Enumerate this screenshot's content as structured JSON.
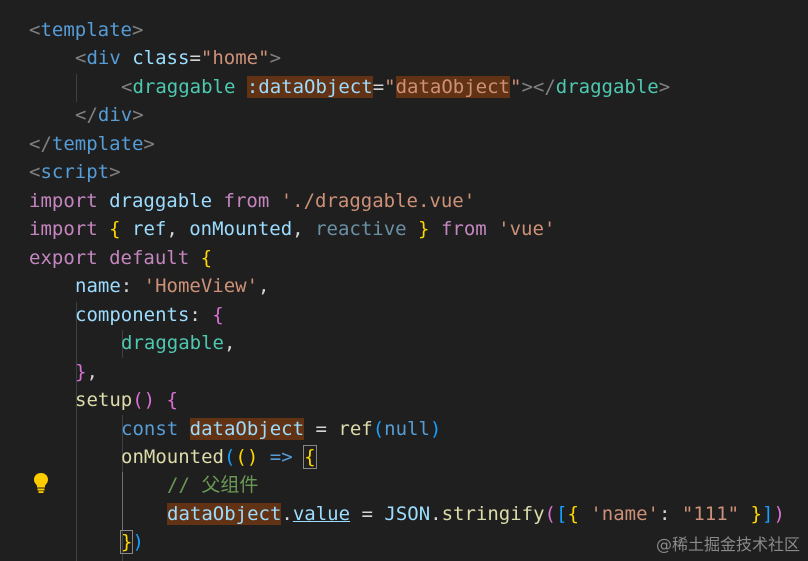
{
  "editor": {
    "language": "vue",
    "lines": [
      "<template>",
      "    <div class=\"home\">",
      "        <draggable :dataObject=\"dataObject\"></draggable>",
      "    </div>",
      "</template>",
      "<script>",
      "import draggable from './draggable.vue'",
      "import { ref, onMounted, reactive } from 'vue'",
      "export default {",
      "    name: 'HomeView',",
      "    components: {",
      "        draggable,",
      "    },",
      "    setup() {",
      "        const dataObject = ref(null)",
      "        onMounted(() => {",
      "            // 父组件",
      "            dataObject.value = JSON.stringify([{ 'name': \"111\" }])",
      "        })"
    ],
    "tokens": {
      "template_tag": "template",
      "div_tag": "div",
      "class_attr": "class",
      "class_value": "home",
      "draggable_tag": "draggable",
      "prop_attr": ":dataObject",
      "prop_value": "dataObject",
      "script_tag": "script",
      "import_kw": "import",
      "from_kw": "from",
      "draggable_ident": "draggable",
      "draggable_path": "'./draggable.vue'",
      "ref_ident": "ref",
      "onmounted_ident": "onMounted",
      "reactive_ident": "reactive",
      "vue_str": "'vue'",
      "export_kw": "export",
      "default_kw": "default",
      "name_key": "name",
      "name_value": "'HomeView'",
      "components_key": "components",
      "setup_fn": "setup",
      "const_kw": "const",
      "dataobject_var": "dataObject",
      "null_kw": "null",
      "arrow": "=>",
      "comment": "// 父组件",
      "value_prop": "value",
      "json_ident": "JSON",
      "stringify_fn": "stringify",
      "name_str": "'name'",
      "num_str": "\"111\""
    },
    "lightbulb_icon": "lightbulb-icon"
  },
  "watermark": "@稀土掘金技术社区"
}
